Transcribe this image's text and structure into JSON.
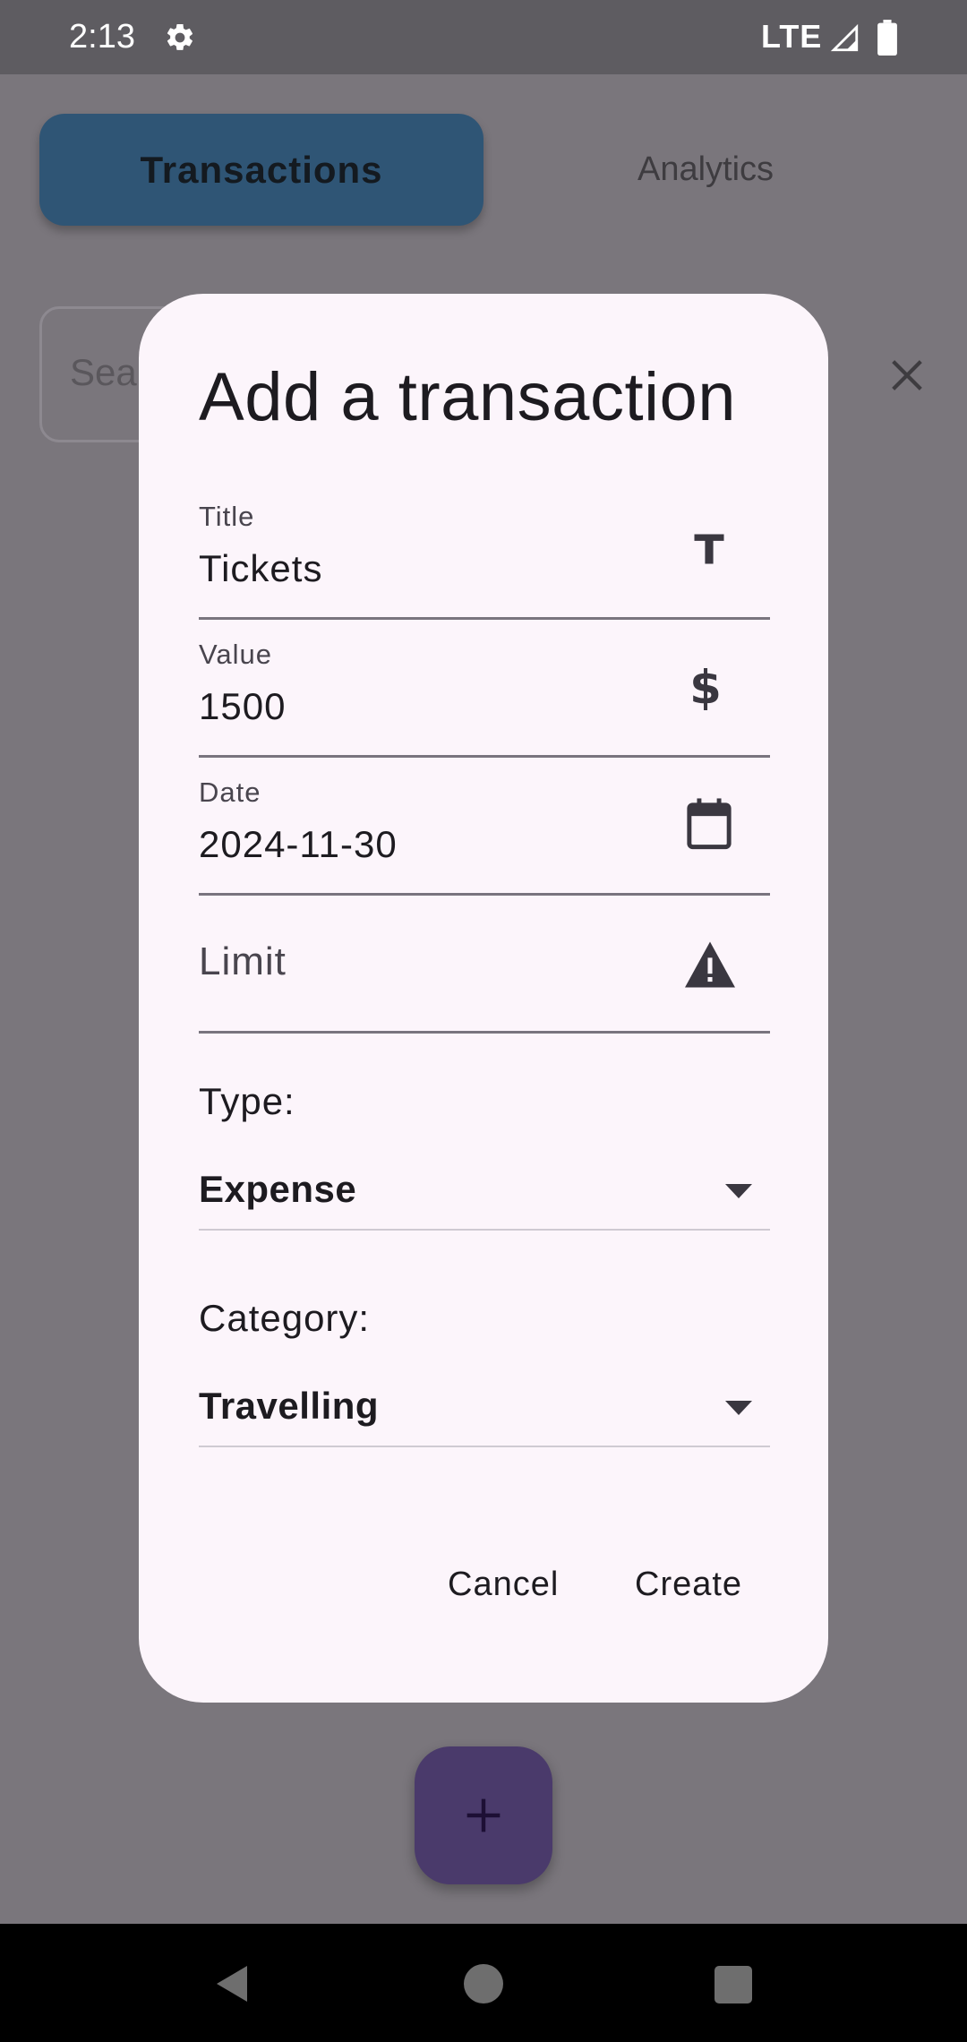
{
  "status_bar": {
    "time": "2:13",
    "network": "LTE",
    "icons": [
      "gear-icon",
      "signal-icon",
      "battery-icon"
    ]
  },
  "tabs": [
    {
      "label": "Transactions",
      "active": true
    },
    {
      "label": "Analytics",
      "active": false
    }
  ],
  "search": {
    "placeholder": "Sea"
  },
  "dialog": {
    "title": "Add a transaction",
    "fields": {
      "title": {
        "label": "Title",
        "value": "Tickets",
        "icon": "text-t-icon"
      },
      "value": {
        "label": "Value",
        "value": "1500",
        "icon": "dollar-icon"
      },
      "date": {
        "label": "Date",
        "value": "2024-11-30",
        "icon": "calendar-icon"
      },
      "limit": {
        "placeholder": "Limit",
        "icon": "warning-icon"
      }
    },
    "type": {
      "label": "Type:",
      "selected": "Expense"
    },
    "category": {
      "label": "Category:",
      "selected": "Travelling"
    },
    "actions": {
      "cancel": "Cancel",
      "create": "Create"
    }
  },
  "fab": {
    "icon": "plus-icon"
  },
  "colors": {
    "dialog_bg": "#fcf5fb",
    "scrim": "#7a767c",
    "tab_active": "#2f5575",
    "fab": "#4a3a6b",
    "text": "#1d1b20"
  }
}
